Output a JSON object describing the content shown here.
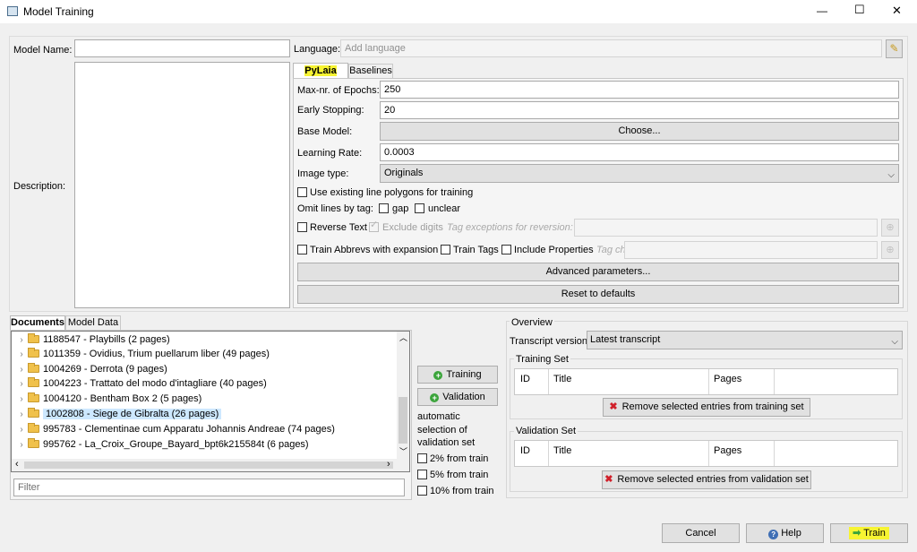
{
  "window": {
    "title": "Model Training",
    "minimize": "—",
    "maximize": "☐",
    "close": "✕"
  },
  "model_name_label": "Model Name:",
  "model_name_value": "",
  "language_label": "Language:",
  "language_placeholder": "Add language",
  "description_label": "Description:",
  "tabs": {
    "pylaia": "PyLaia HTR",
    "baselines": "Baselines"
  },
  "params": {
    "epochs_label": "Max-nr. of Epochs:",
    "epochs_value": "250",
    "early_label": "Early Stopping:",
    "early_value": "20",
    "base_model_label": "Base Model:",
    "choose_label": "Choose...",
    "lr_label": "Learning Rate:",
    "lr_value": "0.0003",
    "image_type_label": "Image type:",
    "image_type_value": "Originals",
    "use_polygons": "Use existing line polygons for training",
    "omit_label": "Omit lines by tag:",
    "gap": "gap",
    "unclear": "unclear",
    "reverse_text": "Reverse Text",
    "exclude_digits": "Exclude digits",
    "tag_exceptions_label": "Tag exceptions for reversion:",
    "train_abbrevs": "Train Abbrevs with expansion",
    "train_tags": "Train Tags",
    "include_props": "Include Properties",
    "tag_choice_label": "Tag choice:",
    "advanced": "Advanced parameters...",
    "reset": "Reset to defaults"
  },
  "doc_tabs": {
    "documents": "Documents",
    "model_data": "Model Data"
  },
  "documents": [
    "1188547 - Playbills (2 pages)",
    "1011359 - Ovidius, Trium puellarum liber (49 pages)",
    "1004269 - Derrota (9 pages)",
    "1004223 - Trattato del modo d'intagliare (40 pages)",
    "1004120 - Bentham Box 2 (5 pages)",
    "1002808 - Siege de Gibralta (26 pages)",
    "995783 - Clementinae cum Apparatu Johannis Andreae (74 pages)",
    "995762 - La_Croix_Groupe_Bayard_bpt6k215584t (6 pages)"
  ],
  "filter_placeholder": "Filter",
  "middle": {
    "training_btn": "Training",
    "validation_btn": "Validation",
    "auto_text_1": "automatic",
    "auto_text_2": "selection of",
    "auto_text_3": "validation set",
    "pct2": "2% from train",
    "pct5": "5% from train",
    "pct10": "10% from train"
  },
  "overview": {
    "title": "Overview",
    "transcript_label": "Transcript version",
    "transcript_value": "Latest transcript",
    "training_set": "Training Set",
    "validation_set": "Validation Set",
    "col_id": "ID",
    "col_title": "Title",
    "col_pages": "Pages",
    "remove_training": "Remove selected entries from training set",
    "remove_validation": "Remove selected entries from validation set"
  },
  "buttons": {
    "cancel": "Cancel",
    "help": "Help",
    "train": "Train"
  },
  "colors": {
    "highlight": "#f7f432",
    "selection": "#cde8ff"
  }
}
